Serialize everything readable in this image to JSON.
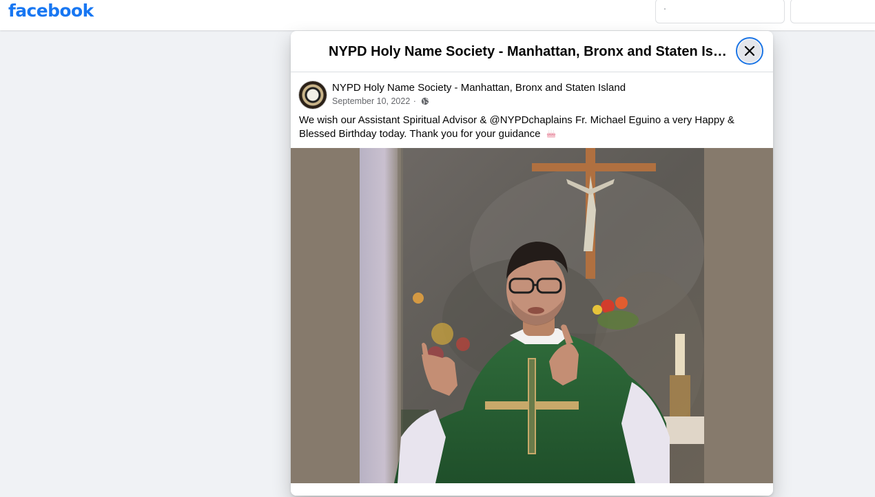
{
  "app": {
    "logo_text": "facebook",
    "brand_color": "#1877f2"
  },
  "modal": {
    "title": "NYPD Holy Name Society - Manhattan, Bronx and Staten Island",
    "close_icon": "close-icon"
  },
  "post": {
    "author": "NYPD Holy Name Society - Manhattan, Bronx and Staten Island",
    "date": "September 10, 2022",
    "separator": "·",
    "privacy_icon": "globe-icon",
    "text_line1": "We wish our Assistant Spiritual Advisor & @NYPDchaplains Fr. Michael Eguino a very Happy &",
    "text_line2": "Blessed Birthday today. Thank you for your guidance",
    "emoji_icon": "birthday-cake-icon",
    "photo_icon": "priest-photo"
  }
}
